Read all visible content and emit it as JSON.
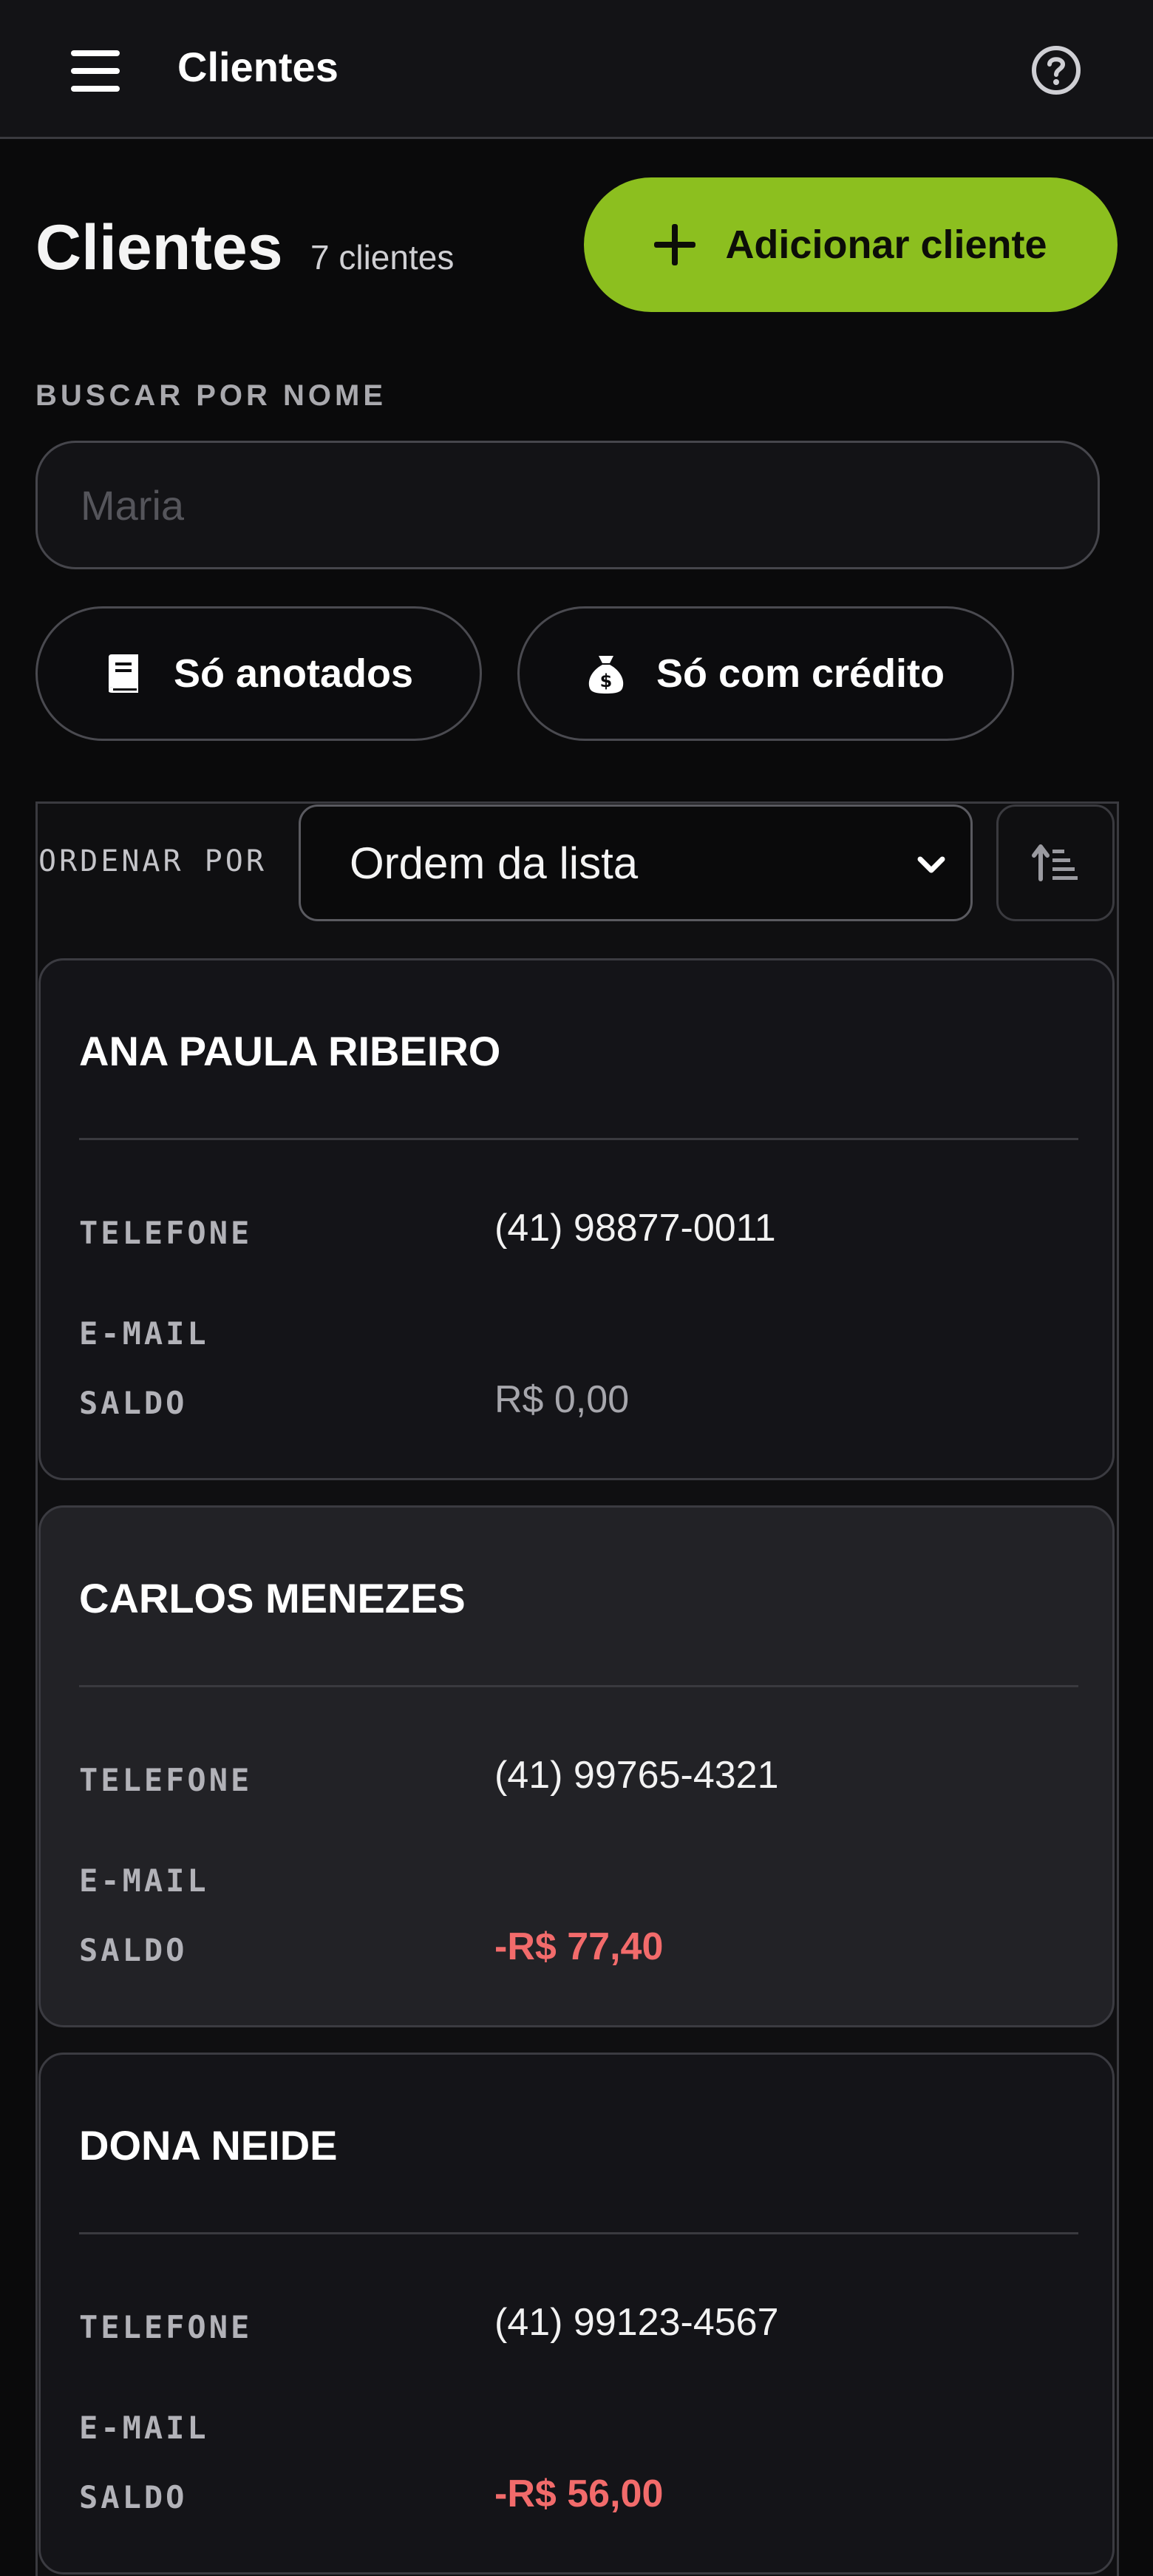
{
  "header": {
    "title": "Clientes"
  },
  "page": {
    "title": "Clientes",
    "count": "7 clientes",
    "add_button_label": "Adicionar cliente"
  },
  "search": {
    "label": "BUSCAR POR NOME",
    "placeholder": "Maria",
    "value": ""
  },
  "filters": {
    "annotated_label": "Só anotados",
    "credit_label": "Só com crédito"
  },
  "sort": {
    "label": "ORDENAR POR",
    "selected": "Ordem da lista"
  },
  "fields": {
    "phone": "TELEFONE",
    "email": "E-MAIL",
    "balance": "SALDO"
  },
  "clients": [
    {
      "name": "ANA PAULA RIBEIRO",
      "phone": "(41) 98877-0011",
      "email": "",
      "balance": "R$ 0,00"
    },
    {
      "name": "CARLOS MENEZES",
      "phone": "(41) 99765-4321",
      "email": "",
      "balance": "-R$ 77,40"
    },
    {
      "name": "DONA NEIDE",
      "phone": "(41) 99123-4567",
      "email": "",
      "balance": "-R$ 56,00"
    }
  ],
  "colors": {
    "accent": "#8cbf1f",
    "negative": "#f26b6b",
    "background": "#0a0a0b"
  },
  "icons": {
    "menu": "hamburger-icon",
    "help": "help-circle-icon",
    "add": "plus-icon",
    "annotated": "notebook-icon",
    "credit": "money-bag-icon",
    "sort_select": "chevron-down-icon",
    "sort_order": "sort-ascending-icon"
  }
}
